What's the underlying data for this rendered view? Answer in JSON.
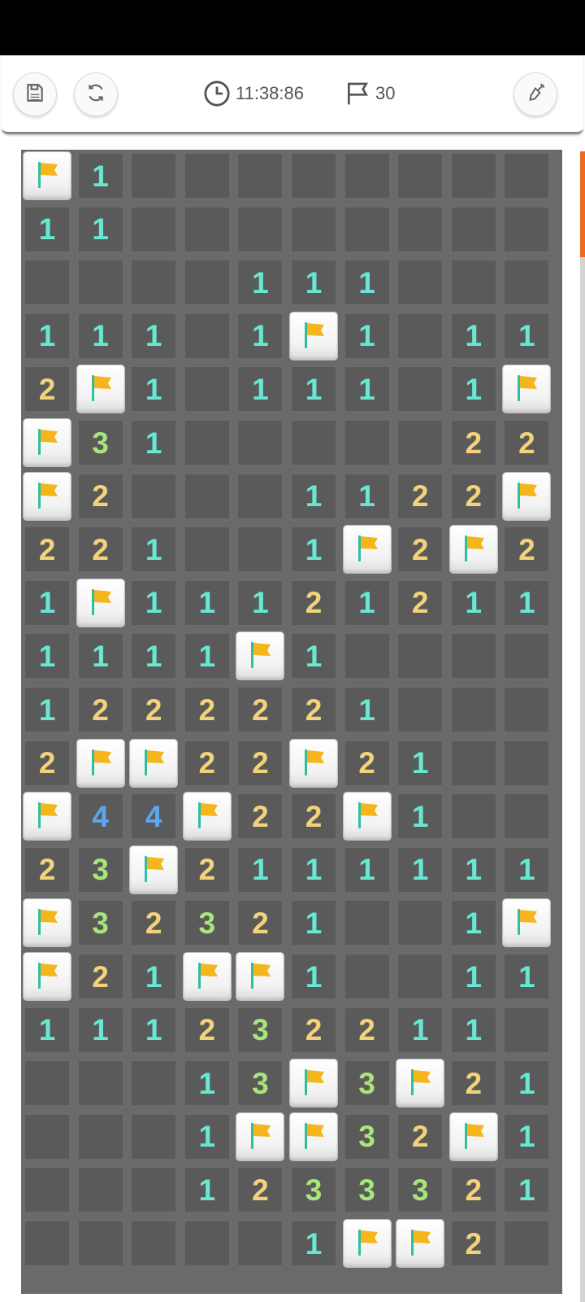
{
  "header": {
    "save_icon": "save-icon",
    "restart_icon": "restart-icon",
    "settings_icon": "shovel-icon",
    "timer": "11:38:86",
    "flags_remaining": "30"
  },
  "colors": {
    "one": "#67e8d2",
    "two": "#f4d27a",
    "three": "#a8e57a",
    "four": "#5ba7f0",
    "flag": "#f5b51c",
    "scroll_thumb": "#f06a1e"
  },
  "board": {
    "rows": [
      [
        "F",
        "1",
        "",
        "",
        "",
        "",
        "",
        "",
        "",
        ""
      ],
      [
        "1",
        "1",
        "",
        "",
        "",
        "",
        "",
        "",
        "",
        ""
      ],
      [
        "",
        "",
        "",
        "",
        "1",
        "1",
        "1",
        "",
        "",
        ""
      ],
      [
        "1",
        "1",
        "1",
        "",
        "1",
        "F",
        "1",
        "",
        "1",
        "1"
      ],
      [
        "2",
        "F",
        "1",
        "",
        "1",
        "1",
        "1",
        "",
        "1",
        "F"
      ],
      [
        "F",
        "3",
        "1",
        "",
        "",
        "",
        "",
        "",
        "2",
        "2"
      ],
      [
        "F",
        "2",
        "",
        "",
        "",
        "1",
        "1",
        "2",
        "2",
        "F"
      ],
      [
        "2",
        "2",
        "1",
        "",
        "",
        "1",
        "F",
        "2",
        "F",
        "2"
      ],
      [
        "1",
        "F",
        "1",
        "1",
        "1",
        "2",
        "1",
        "2",
        "1",
        "1"
      ],
      [
        "1",
        "1",
        "1",
        "1",
        "F",
        "1",
        "",
        "",
        "",
        ""
      ],
      [
        "1",
        "2",
        "2",
        "2",
        "2",
        "2",
        "1",
        "",
        "",
        ""
      ],
      [
        "2",
        "F",
        "F",
        "2",
        "2",
        "F",
        "2",
        "1",
        "",
        ""
      ],
      [
        "F",
        "4",
        "4",
        "F",
        "2",
        "2",
        "F",
        "1",
        "",
        ""
      ],
      [
        "2",
        "3",
        "F",
        "2",
        "1",
        "1",
        "1",
        "1",
        "1",
        "1"
      ],
      [
        "F",
        "3",
        "2",
        "3",
        "2",
        "1",
        "",
        "",
        "1",
        "F"
      ],
      [
        "F",
        "2",
        "1",
        "F",
        "F",
        "1",
        "",
        "",
        "1",
        "1"
      ],
      [
        "1",
        "1",
        "1",
        "2",
        "3",
        "2",
        "2",
        "1",
        "1",
        ""
      ],
      [
        "",
        "",
        "",
        "1",
        "3",
        "F",
        "3",
        "F",
        "2",
        "1"
      ],
      [
        "",
        "",
        "",
        "1",
        "F",
        "F",
        "3",
        "2",
        "F",
        "1"
      ],
      [
        "",
        "",
        "",
        "1",
        "2",
        "3",
        "3",
        "3",
        "2",
        "1"
      ],
      [
        "",
        "",
        "",
        "",
        "",
        "1",
        "F",
        "F",
        "2",
        ""
      ]
    ]
  }
}
